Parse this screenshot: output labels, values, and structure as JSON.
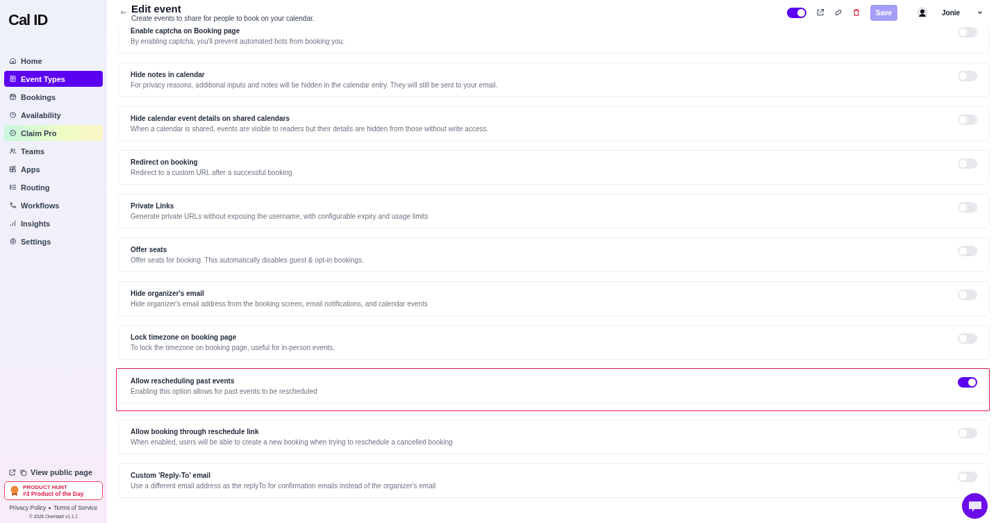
{
  "sidebar": {
    "logo": "Cal ID",
    "items": [
      {
        "label": "Home",
        "selected": false,
        "kind": "normal"
      },
      {
        "label": "Event Types",
        "selected": true,
        "kind": "normal"
      },
      {
        "label": "Bookings",
        "selected": false,
        "kind": "normal"
      },
      {
        "label": "Availability",
        "selected": false,
        "kind": "normal"
      },
      {
        "label": "Claim Pro",
        "selected": false,
        "kind": "promo"
      },
      {
        "label": "Teams",
        "selected": false,
        "kind": "normal"
      },
      {
        "label": "Apps",
        "selected": false,
        "kind": "normal"
      },
      {
        "label": "Routing",
        "selected": false,
        "kind": "normal"
      },
      {
        "label": "Workflows",
        "selected": false,
        "kind": "normal"
      },
      {
        "label": "Insights",
        "selected": false,
        "kind": "normal"
      },
      {
        "label": "Settings",
        "selected": false,
        "kind": "normal"
      }
    ],
    "public_page": "View public page",
    "product_hunt": {
      "overline": "PRODUCT HUNT",
      "title": "#3 Product of the Day"
    },
    "footer_links": [
      "Privacy Policy",
      "Terms of Service"
    ],
    "copyright": "© 2026 OneHash v1.1.1"
  },
  "header": {
    "title": "Edit event",
    "subtitle": "Create events to share for people to book on your calendar.",
    "enabled": true,
    "save": "Save",
    "save_disabled": true,
    "user": "Jonie"
  },
  "settings": [
    {
      "title": "Enable captcha on Booking page",
      "description": "By enabling captcha, you'll prevent automated bots from booking you.",
      "on": false,
      "highlighted": false
    },
    {
      "title": "Hide notes in calendar",
      "description": "For privacy reasons, additional inputs and notes will be hidden in the calendar entry. They will still be sent to your email.",
      "on": false,
      "highlighted": false
    },
    {
      "title": "Hide calendar event details on shared calendars",
      "description": "When a calendar is shared, events are visible to readers but their details are hidden from those without write access.",
      "on": false,
      "highlighted": false
    },
    {
      "title": "Redirect on booking",
      "description": "Redirect to a custom URL after a successful booking",
      "on": false,
      "highlighted": false
    },
    {
      "title": "Private Links",
      "description": "Generate private URLs without exposing the username, with configurable expiry and usage limits",
      "on": false,
      "highlighted": false
    },
    {
      "title": "Offer seats",
      "description": "Offer seats for booking. This automatically disables guest & opt-in bookings.",
      "on": false,
      "highlighted": false
    },
    {
      "title": "Hide organizer's email",
      "description": "Hide organizer's email address from the booking screen, email notifications, and calendar events",
      "on": false,
      "highlighted": false
    },
    {
      "title": "Lock timezone on booking page",
      "description": "To lock the timezone on booking page, useful for in-person events.",
      "on": false,
      "highlighted": false
    },
    {
      "title": "Allow rescheduling past events",
      "description": "Enabling this option allows for past events to be rescheduled",
      "on": true,
      "highlighted": true
    },
    {
      "title": "Allow booking through reschedule link",
      "description": "When enabled, users will be able to create a new booking when trying to reschedule a cancelled booking",
      "on": false,
      "highlighted": false
    },
    {
      "title": "Custom 'Reply-To' email",
      "description": "Use a different email address as the replyTo for confirmation emails instead of the organizer's email",
      "on": false,
      "highlighted": false
    }
  ]
}
